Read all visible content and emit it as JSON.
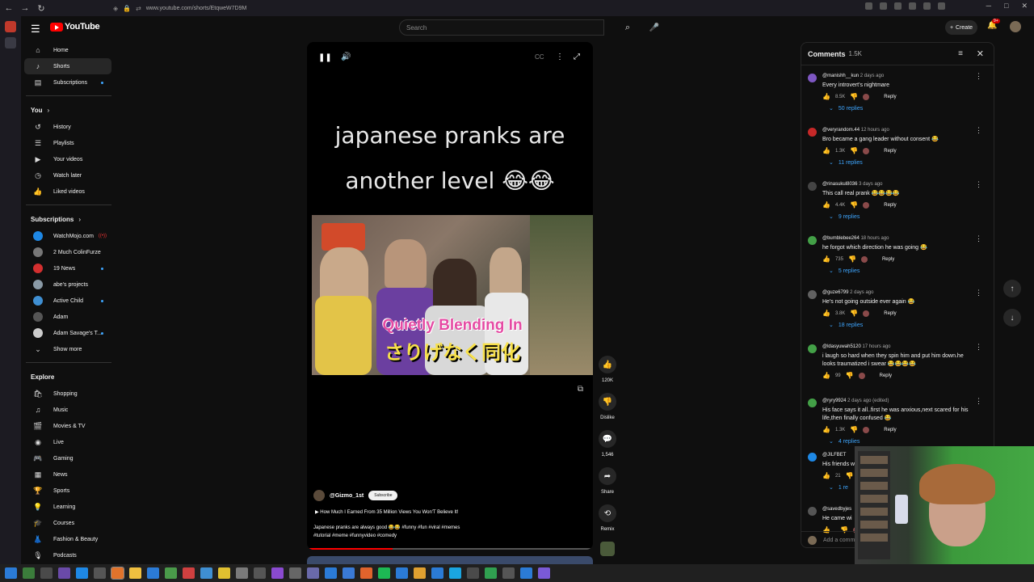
{
  "browser": {
    "url": "www.youtube.com/shorts/EtqweW7D9M"
  },
  "header": {
    "logo_text": "YouTube",
    "search_placeholder": "Search",
    "create_label": "Create",
    "notif_badge": "9+"
  },
  "sidebar": {
    "main": [
      {
        "label": "Home",
        "icon": "home-icon",
        "glyph": "⌂"
      },
      {
        "label": "Shorts",
        "icon": "shorts-icon",
        "glyph": "♪"
      },
      {
        "label": "Subscriptions",
        "icon": "subscriptions-icon",
        "glyph": "▤"
      }
    ],
    "you_heading": "You",
    "you": [
      {
        "label": "History",
        "icon": "history-icon",
        "glyph": "↺"
      },
      {
        "label": "Playlists",
        "icon": "playlists-icon",
        "glyph": "☰"
      },
      {
        "label": "Your videos",
        "icon": "your-videos-icon",
        "glyph": "▶"
      },
      {
        "label": "Watch later",
        "icon": "watch-later-icon",
        "glyph": "◷"
      },
      {
        "label": "Liked videos",
        "icon": "liked-videos-icon",
        "glyph": "👍"
      }
    ],
    "subs_heading": "Subscriptions",
    "subs": [
      {
        "label": "WatchMojo.com",
        "color": "#1e88e5",
        "live": true
      },
      {
        "label": "2 Much ColinFurze",
        "color": "#777777"
      },
      {
        "label": "19 News",
        "color": "#d32f2f",
        "dot": true
      },
      {
        "label": "abe's projects",
        "color": "#8a9aa6"
      },
      {
        "label": "Active Child",
        "color": "#3f8fd2",
        "dot": true
      },
      {
        "label": "Adam",
        "color": "#555555"
      },
      {
        "label": "Adam Savage's T...",
        "color": "#cccccc",
        "dot": true
      }
    ],
    "show_more": "Show more",
    "explore_heading": "Explore",
    "explore": [
      {
        "label": "Shopping",
        "icon": "shopping-icon",
        "glyph": "🛍"
      },
      {
        "label": "Music",
        "icon": "music-icon",
        "glyph": "♫"
      },
      {
        "label": "Movies & TV",
        "icon": "movies-icon",
        "glyph": "🎬"
      },
      {
        "label": "Live",
        "icon": "live-icon",
        "glyph": "◉"
      },
      {
        "label": "Gaming",
        "icon": "gaming-icon",
        "glyph": "🎮"
      },
      {
        "label": "News",
        "icon": "news-icon",
        "glyph": "▦"
      },
      {
        "label": "Sports",
        "icon": "sports-icon",
        "glyph": "🏆"
      },
      {
        "label": "Learning",
        "icon": "learning-icon",
        "glyph": "💡"
      },
      {
        "label": "Courses",
        "icon": "courses-icon",
        "glyph": "🎓"
      },
      {
        "label": "Fashion & Beauty",
        "icon": "fashion-icon",
        "glyph": "👗"
      },
      {
        "label": "Podcasts",
        "icon": "podcasts-icon",
        "glyph": "🎙"
      }
    ]
  },
  "player": {
    "caption_line1": "japanese pranks are",
    "caption_line2": "another level 😂😂",
    "frame_sub_en": "Quietly Blending In",
    "frame_sub_jp": "さりげなく同化",
    "channel": "@Gizmo_1st",
    "subscribe": "Subscribe",
    "playlist": "▶  How Much I Earned From 35 Million Views You Won'T Believe It!",
    "desc_line1": "Japanese pranks are always good 😂😂 #funny #fun #viral #memes",
    "desc_line2": "#tutorial #meme #funnyvideo #comedy",
    "progress": 0.3
  },
  "actions": {
    "like_count": "120K",
    "dislike": "Dislike",
    "comments_count": "1,546",
    "share": "Share",
    "remix": "Remix"
  },
  "comments": {
    "title": "Comments",
    "count": "1.5K",
    "add_placeholder": "Add a comment...",
    "items": [
      {
        "user": "@manishh__kun",
        "when": "2 days ago",
        "text": "Every introvert's nightmare",
        "likes": "8.5K",
        "replies": "50 replies",
        "color": "#7e57c2"
      },
      {
        "user": "@veryrandom.44",
        "when": "12 hours ago",
        "text": "Bro became a gang leader without consent 😂",
        "likes": "1.3K",
        "replies": "11 replies",
        "color": "#c62828"
      },
      {
        "user": "@rinasukul8036",
        "when": "3 days ago",
        "text": "This call real prank 😂😂😂😂",
        "likes": "4.4K",
        "replies": "9 replies",
        "color": "#444444"
      },
      {
        "user": "@bumblebee264",
        "when": "18 hours ago",
        "text": "he forgot which direction he was going 😂",
        "likes": "735",
        "replies": "5 replies",
        "color": "#43a047"
      },
      {
        "user": "@guze6799",
        "when": "2 days ago",
        "text": "He's not going outside ever again 😂",
        "likes": "3.8K",
        "replies": "18 replies",
        "color": "#616161"
      },
      {
        "user": "@ldasyuwah5120",
        "when": "17 hours ago",
        "text": "i laugh so hard when they spin him and put him down.he looks traumatized i swear 😂😂😂😂",
        "likes": "99",
        "replies": "",
        "color": "#43a047"
      },
      {
        "user": "@ryry9924",
        "when": "2 days ago (edited)",
        "text": "His face says it all..first he was anxious,next scared for his life,then finally confused 😂",
        "likes": "1.3K",
        "replies": "4 replies",
        "color": "#43a047"
      },
      {
        "user": "@JILFBET",
        "when": "",
        "text": "His friends w",
        "likes": "21",
        "replies": "1 re",
        "color": "#1e88e5"
      },
      {
        "user": "@savedbyjes",
        "when": "",
        "text": "He came wi",
        "likes": "",
        "replies": "",
        "color": "#555555"
      }
    ]
  },
  "reply_label": "Reply"
}
